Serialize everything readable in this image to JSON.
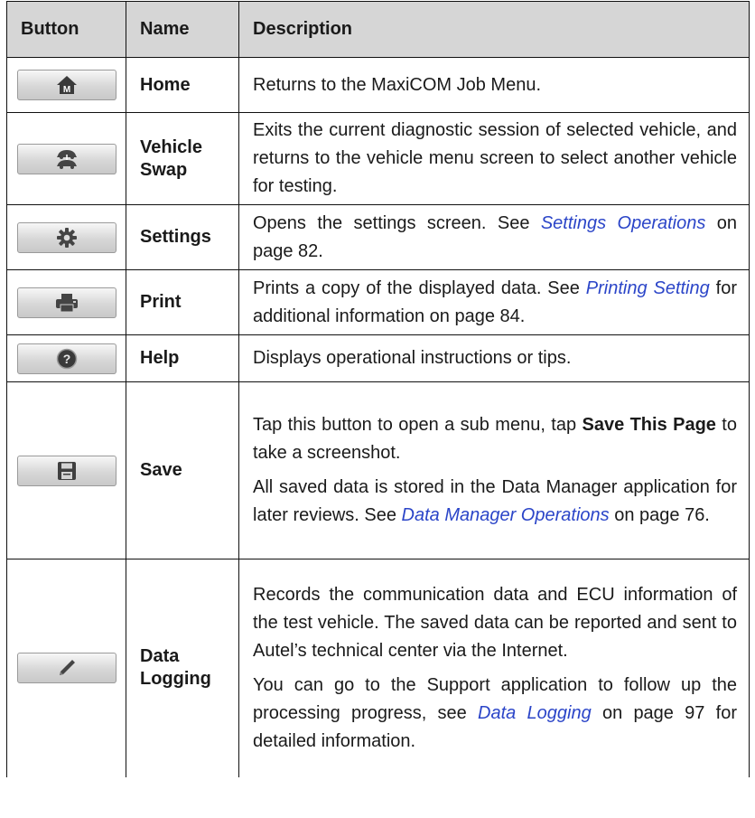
{
  "table": {
    "headers": {
      "button": "Button",
      "name": "Name",
      "description": "Description"
    },
    "rows": [
      {
        "icon": "home-icon",
        "name": "Home",
        "desc": {
          "t1": "Returns to the MaxiCOM Job Menu."
        }
      },
      {
        "icon": "vehicle-swap-icon",
        "name": "Vehicle Swap",
        "desc": {
          "t1": "Exits the current diagnostic session of selected vehicle, and returns to the vehicle menu screen to select another vehicle for testing."
        }
      },
      {
        "icon": "gear-icon",
        "name": "Settings",
        "desc": {
          "t1": "Opens the settings screen. See ",
          "link": "Settings Operations",
          "t2": " on page 82."
        }
      },
      {
        "icon": "printer-icon",
        "name": "Print",
        "desc": {
          "t1": "Prints a copy of the displayed data. See ",
          "link": "Printing Setting",
          "t2": " for additional information on page 84."
        }
      },
      {
        "icon": "help-icon",
        "name": "Help",
        "desc": {
          "t1": "Displays operational instructions or tips."
        }
      },
      {
        "icon": "save-icon",
        "name": "Save",
        "desc": {
          "p1_t1": "Tap this button to open a sub menu, tap ",
          "p1_bold": "Save This Page",
          "p1_t2": " to take a screenshot.",
          "p2_t1": "All saved data is stored in the Data Manager application for later reviews. See ",
          "p2_link": "Data Manager Operations",
          "p2_t2": " on page 76."
        }
      },
      {
        "icon": "pencil-icon",
        "name": "Data Logging",
        "desc": {
          "p1": "Records the communication data and ECU information of the test vehicle. The saved data can be reported and sent to Autel’s technical center via the Internet.",
          "p2_t1": "You can go to the Support application to follow up the processing progress, see ",
          "p2_link": "Data Logging",
          "p2_t2": " on page 97 for detailed information."
        }
      }
    ]
  },
  "colors": {
    "header_bg": "#d6d6d6",
    "link": "#2b45c8",
    "border": "#111111"
  }
}
